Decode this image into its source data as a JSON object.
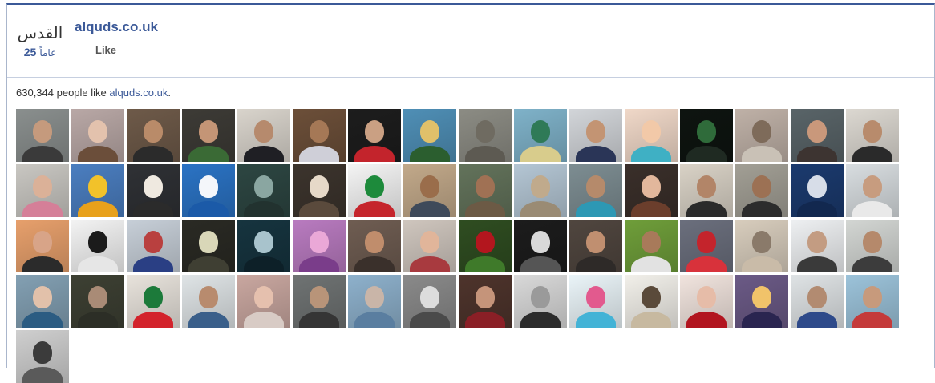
{
  "header": {
    "logo_arabic": "القدس",
    "logo_number": "25",
    "logo_word": "عاماً",
    "page_name": "alquds.co.uk",
    "like_label": "Like"
  },
  "likes": {
    "count_text": "630,344 people like ",
    "page_link": "alquds.co.uk",
    "suffix": "."
  },
  "faces": [
    {
      "bg": "#8a8f8e",
      "skin": "#c59a7d",
      "cloth": "#3a3a3a"
    },
    {
      "bg": "#b9a8a6",
      "skin": "#e3c2ad",
      "cloth": "#6b4e3a"
    },
    {
      "bg": "#6e5a49",
      "skin": "#b98b69",
      "cloth": "#2b2b2b"
    },
    {
      "bg": "#3d3b36",
      "skin": "#c49576",
      "cloth": "#3a6a35"
    },
    {
      "bg": "#d9d4cc",
      "skin": "#b68a6d",
      "cloth": "#1f1f24"
    },
    {
      "bg": "#6c4f39",
      "skin": "#a57856",
      "cloth": "#cfcfd8"
    },
    {
      "bg": "#1d1d1d",
      "skin": "#caa083",
      "cloth": "#c3242c"
    },
    {
      "bg": "#4f8fb6",
      "skin": "#e0c06a",
      "cloth": "#2b5e2f"
    },
    {
      "bg": "#8c8c84",
      "skin": "#6f6b61",
      "cloth": "#5d5a52"
    },
    {
      "bg": "#7fb2c9",
      "skin": "#2f7a57",
      "cloth": "#d8cc8c"
    },
    {
      "bg": "#d2d5d9",
      "skin": "#c39473",
      "cloth": "#2a3557"
    },
    {
      "bg": "#f0d8c8",
      "skin": "#f2c9a8",
      "cloth": "#3fb0c4"
    },
    {
      "bg": "#0e1410",
      "skin": "#2f6b3a",
      "cloth": "#1f2a22"
    },
    {
      "bg": "#bfb1a7",
      "skin": "#7e6b5a",
      "cloth": "#c9c1b6"
    },
    {
      "bg": "#596468",
      "skin": "#c9987b",
      "cloth": "#3d3431"
    },
    {
      "bg": "#dcd8d1",
      "skin": "#b88b6c",
      "cloth": "#2a2a2a"
    },
    {
      "bg": "#c9c7c2",
      "skin": "#dbb198",
      "cloth": "#d57f98"
    },
    {
      "bg": "#4b7ec0",
      "skin": "#f2c22a",
      "cloth": "#e8a11b"
    },
    {
      "bg": "#2f3135",
      "skin": "#efe9e0",
      "cloth": "#2b2b2b"
    },
    {
      "bg": "#2b73c4",
      "skin": "#f4f6fa",
      "cloth": "#1b5aa8"
    },
    {
      "bg": "#2d4642",
      "skin": "#8aa6a1",
      "cloth": "#22322f"
    },
    {
      "bg": "#3c342d",
      "skin": "#e6d9c8",
      "cloth": "#5a4a3c"
    },
    {
      "bg": "#f4f4f4",
      "skin": "#1d8a3b",
      "cloth": "#c5252c"
    },
    {
      "bg": "#c2a98a",
      "skin": "#9a6d4b",
      "cloth": "#3f4a5a"
    },
    {
      "bg": "#63735b",
      "skin": "#a07154",
      "cloth": "#6c5a45"
    },
    {
      "bg": "#b4c6d4",
      "skin": "#c0aa8c",
      "cloth": "#9a8b74"
    },
    {
      "bg": "#7d8d92",
      "skin": "#b58a6b",
      "cloth": "#2d98b4"
    },
    {
      "bg": "#3a2f2a",
      "skin": "#e2b79c",
      "cloth": "#6b3e2c"
    },
    {
      "bg": "#d9d2c6",
      "skin": "#b28568",
      "cloth": "#2b2b2b"
    },
    {
      "bg": "#a29f95",
      "skin": "#9c7154",
      "cloth": "#2c2c2c"
    },
    {
      "bg": "#1b3a6e",
      "skin": "#d7dde8",
      "cloth": "#12284f"
    },
    {
      "bg": "#d8dde0",
      "skin": "#c79c7f",
      "cloth": "#e9e9e9"
    },
    {
      "bg": "#e7a06c",
      "skin": "#d8a488",
      "cloth": "#2b2b2b"
    },
    {
      "bg": "#f3f3f3",
      "skin": "#1b1b1b",
      "cloth": "#e6e6e6"
    },
    {
      "bg": "#c7cfd8",
      "skin": "#b9403f",
      "cloth": "#2a3f84"
    },
    {
      "bg": "#2a2a24",
      "skin": "#d9d7b8",
      "cloth": "#3f3f33"
    },
    {
      "bg": "#16343f",
      "skin": "#a8c3cc",
      "cloth": "#0d2028"
    },
    {
      "bg": "#b97bc0",
      "skin": "#eaa8d7",
      "cloth": "#7a3d8a"
    },
    {
      "bg": "#6f5d52",
      "skin": "#c08d6c",
      "cloth": "#3a302b"
    },
    {
      "bg": "#cfc6be",
      "skin": "#e1b59a",
      "cloth": "#a83a3f"
    },
    {
      "bg": "#2f4d21",
      "skin": "#b3161e",
      "cloth": "#3f7a2a"
    },
    {
      "bg": "#1c1c1c",
      "skin": "#d8d8d8",
      "cloth": "#555555"
    },
    {
      "bg": "#50463f",
      "skin": "#c08f70",
      "cloth": "#2e2a28"
    },
    {
      "bg": "#6f9e3a",
      "skin": "#a87a5a",
      "cloth": "#e2e2e2"
    },
    {
      "bg": "#6b6f7d",
      "skin": "#c4242c",
      "cloth": "#d8323b"
    },
    {
      "bg": "#d8cdbd",
      "skin": "#8a7a6a",
      "cloth": "#c9bba8"
    },
    {
      "bg": "#eef0f2",
      "skin": "#c39c82",
      "cloth": "#3a3a3a"
    },
    {
      "bg": "#d3d6d3",
      "skin": "#b5896b",
      "cloth": "#3c3c3c"
    },
    {
      "bg": "#83a0b3",
      "skin": "#e2c1aa",
      "cloth": "#2b5c82"
    },
    {
      "bg": "#3d4033",
      "skin": "#a98b76",
      "cloth": "#2c2e26"
    },
    {
      "bg": "#e8e3dc",
      "skin": "#1c7a3a",
      "cloth": "#d3232b"
    },
    {
      "bg": "#dfe4e6",
      "skin": "#b88b6e",
      "cloth": "#3a5f8a"
    },
    {
      "bg": "#c9a7a0",
      "skin": "#e5c0ae",
      "cloth": "#d8cbc5"
    },
    {
      "bg": "#6f7373",
      "skin": "#b89479",
      "cloth": "#353535"
    },
    {
      "bg": "#8eb1cc",
      "skin": "#c9b5a8",
      "cloth": "#5a7ea0"
    },
    {
      "bg": "#8a8a8a",
      "skin": "#dcdcdc",
      "cloth": "#4a4a4a"
    },
    {
      "bg": "#4e342c",
      "skin": "#c5947a",
      "cloth": "#8a1f26"
    },
    {
      "bg": "#d9d9d9",
      "skin": "#9a9a9a",
      "cloth": "#2c2c2c"
    },
    {
      "bg": "#eaf4f8",
      "skin": "#e25a8e",
      "cloth": "#43b3d6"
    },
    {
      "bg": "#f2f0ea",
      "skin": "#5a4a3a",
      "cloth": "#c7b9a0"
    },
    {
      "bg": "#f1e4de",
      "skin": "#e6bca8",
      "cloth": "#b2151f"
    },
    {
      "bg": "#6b5a86",
      "skin": "#f1c36a",
      "cloth": "#2a2550"
    },
    {
      "bg": "#dfe3e5",
      "skin": "#b28b71",
      "cloth": "#2e4a8a"
    },
    {
      "bg": "#9cc3da",
      "skin": "#c79a7c",
      "cloth": "#c43a3a"
    },
    {
      "bg": "#cfcfcf",
      "skin": "#3b3b3b",
      "cloth": "#5a5a5a"
    }
  ]
}
